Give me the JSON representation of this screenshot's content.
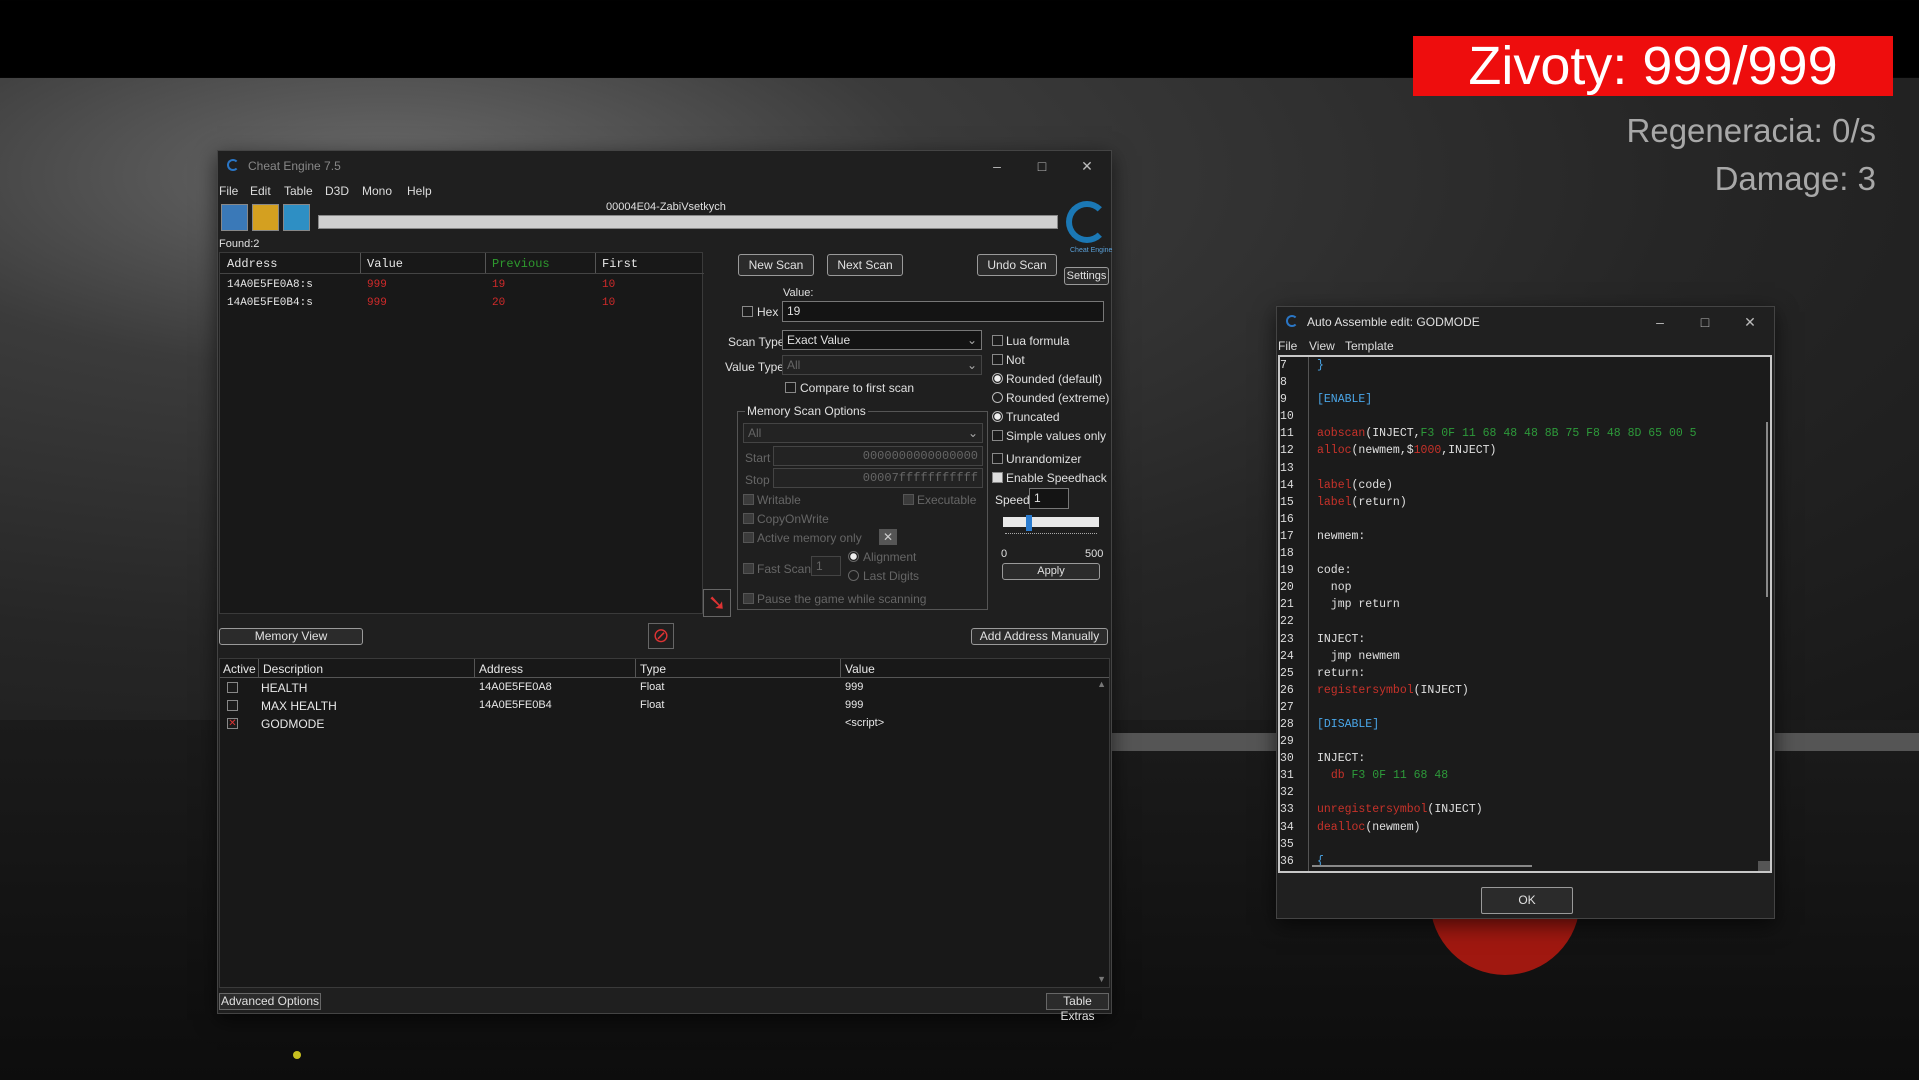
{
  "hud": {
    "health": "Zivoty: 999/999",
    "regen": "Regeneracia: 0/s",
    "damage": "Damage: 3"
  },
  "ce": {
    "title": "Cheat Engine 7.5",
    "menu": [
      "File",
      "Edit",
      "Table",
      "D3D",
      "Mono",
      "Help"
    ],
    "process": "00004E04-ZabiVsetkych",
    "logo_caption": "Cheat Engine",
    "found": "Found:2",
    "results": {
      "headers": [
        "Address",
        "Value",
        "Previous",
        "First"
      ],
      "rows": [
        [
          "14A0E5FE0A8:s",
          "999",
          "19",
          "10"
        ],
        [
          "14A0E5FE0B4:s",
          "999",
          "20",
          "10"
        ]
      ]
    },
    "buttons": {
      "new_scan": "New Scan",
      "next_scan": "Next Scan",
      "undo_scan": "Undo Scan",
      "settings": "Settings",
      "memory_view": "Memory View",
      "add_address": "Add Address Manually",
      "advanced": "Advanced Options",
      "table_extras": "Table Extras",
      "apply": "Apply"
    },
    "value_label": "Value:",
    "hex_label": "Hex",
    "value": "19",
    "scan_type_label": "Scan Type",
    "scan_type": "Exact Value",
    "value_type_label": "Value Type",
    "value_type": "All",
    "compare_first": "Compare to first scan",
    "mem_options": {
      "title": "Memory Scan Options",
      "region": "All",
      "start_label": "Start",
      "start": "0000000000000000",
      "stop_label": "Stop",
      "stop": "00007fffffffffff",
      "writable": "Writable",
      "executable": "Executable",
      "copyonwrite": "CopyOnWrite",
      "active_only": "Active memory only",
      "fast_scan": "Fast Scan",
      "fast_val": "1",
      "alignment": "Alignment",
      "last_digits": "Last Digits",
      "pause": "Pause the game while scanning"
    },
    "right_opts": {
      "lua": "Lua formula",
      "not": "Not",
      "rounded_default": "Rounded (default)",
      "rounded_extreme": "Rounded (extreme)",
      "truncated": "Truncated",
      "simple": "Simple values only",
      "unrandomizer": "Unrandomizer",
      "speedhack": "Enable Speedhack",
      "speed_label": "Speed",
      "speed": "1",
      "slider_min": "0",
      "slider_max": "500"
    },
    "table": {
      "headers": [
        "Active",
        "Description",
        "Address",
        "Type",
        "Value"
      ],
      "rows": [
        {
          "desc": "HEALTH",
          "addr": "14A0E5FE0A8",
          "type": "Float",
          "value": "999"
        },
        {
          "desc": "MAX HEALTH",
          "addr": "14A0E5FE0B4",
          "type": "Float",
          "value": "999"
        },
        {
          "desc": "GODMODE",
          "addr": "",
          "type": "",
          "value": "<script>"
        }
      ]
    }
  },
  "aa": {
    "title": "Auto Assemble edit: GODMODE",
    "menu": [
      "File",
      "View",
      "Template"
    ],
    "ok": "OK",
    "line_numbers": [
      "7",
      "8",
      "9",
      "10",
      "11",
      "12",
      "13",
      "14",
      "15",
      "16",
      "17",
      "18",
      "19",
      "20",
      "21",
      "22",
      "23",
      "24",
      "25",
      "26",
      "27",
      "28",
      "29",
      "30",
      "31",
      "32",
      "33",
      "34",
      "35",
      "36"
    ]
  },
  "colors": {
    "red": "#ee0d0d",
    "previous_header": "#2e9a2e",
    "value_red": "#d02a2a"
  }
}
